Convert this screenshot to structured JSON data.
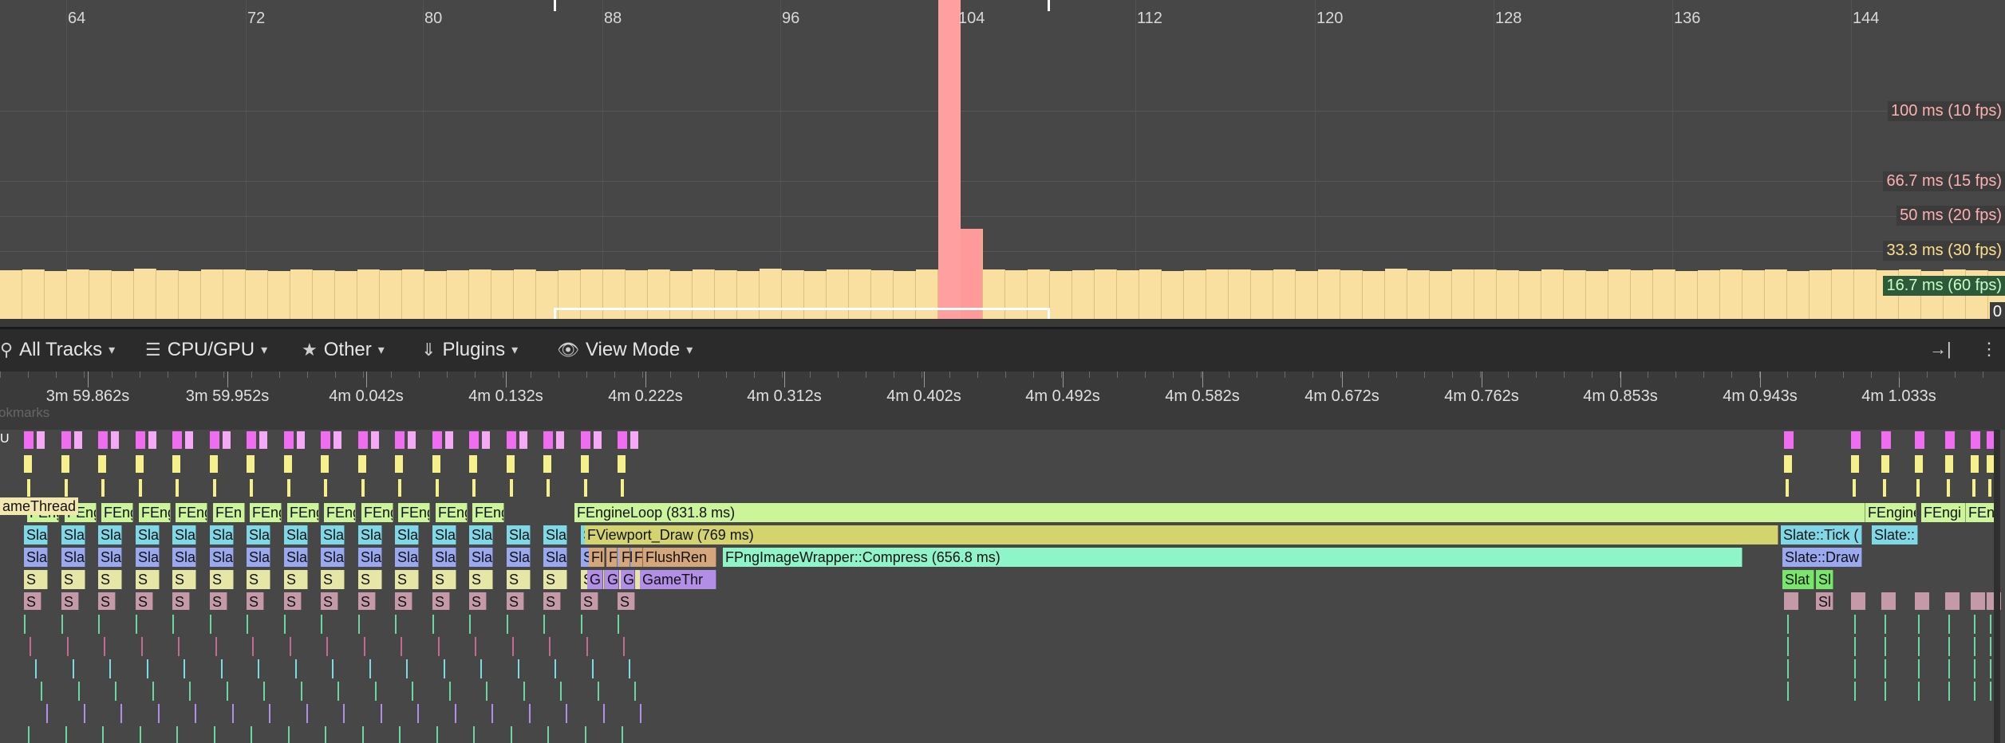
{
  "frames_panel": {
    "frame_numbers": [
      "64",
      "72",
      "80",
      "88",
      "96",
      "104",
      "112",
      "120",
      "128",
      "136",
      "144"
    ],
    "thresholds": [
      {
        "label": "100 ms (10 fps)",
        "color": "#ffb0b0"
      },
      {
        "label": "66.7 ms (15 fps)",
        "color": "#ffb0b0"
      },
      {
        "label": "50 ms (20 fps)",
        "color": "#ffb0b0"
      },
      {
        "label": "33.3 ms (30 fps)",
        "color": "#ffe08a"
      },
      {
        "label": "16.7 ms (60 fps)",
        "color": "#c8ffc8"
      },
      {
        "label": "0",
        "color": "#ffffff"
      }
    ],
    "bar_color": "#f9e0a0",
    "spike_color": "#ff9f9f"
  },
  "toolbar": {
    "all_tracks": "All Tracks",
    "cpu_gpu": "CPU/GPU",
    "other": "Other",
    "plugins": "Plugins",
    "view_mode": "View Mode"
  },
  "ruler": {
    "labels": [
      "3m 59.862s",
      "3m 59.952s",
      "4m 0.042s",
      "4m 0.132s",
      "4m 0.222s",
      "4m 0.312s",
      "4m 0.402s",
      "4m 0.492s",
      "4m 0.582s",
      "4m 0.672s",
      "4m 0.762s",
      "4m 0.853s",
      "4m 0.943s",
      "4m 1.033s"
    ]
  },
  "bookmarks_label": "okmarks",
  "tracks": {
    "gpu_label": "U",
    "game_thread_tag": "ameThread",
    "row1": {
      "engine_loop": "FEngineLoop (831.8 ms)",
      "small_fe": [
        "FEng",
        "FEng",
        "FEng",
        "FEng",
        "FEng",
        "FEn",
        "FEng",
        "FEng",
        "FEng",
        "FEng",
        "FEng",
        "FEng",
        "FEngi"
      ],
      "right1": "FEngine",
      "right2": "FEngi",
      "right3": "FEn"
    },
    "row2": {
      "viewport_draw": "FViewport_Draw (769 ms)",
      "slate_tick": "Slate::Tick (",
      "slate_right": "Slate::",
      "sla": "Sla",
      "slat": "Slat"
    },
    "row3": {
      "compress": "FPngImageWrapper::Compress (656.8 ms)",
      "flush": "FlushRen",
      "slate_draw": "Slate::Draw",
      "fl": "Fl",
      "f": "F"
    },
    "row4": {
      "game_thr": "GameThr",
      "g": "G",
      "s": "S",
      "sl": "Sl",
      "slat": "Slat"
    }
  }
}
